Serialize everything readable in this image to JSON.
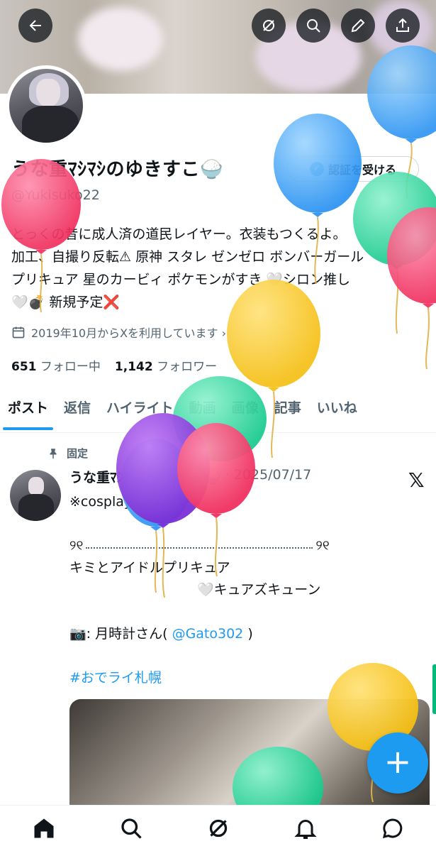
{
  "profile": {
    "display_name": "うな重ﾏｼﾏｼのゆきすこ🍚",
    "handle": "@Yukisuko22",
    "verify_label": "認証を受ける",
    "bio_lines": [
      "とっくの昔に成人済の道民レイヤー。衣装もつくるよ。",
      "加工、自撮り反転⚠ 原神 スタレ ゼンゼロ ボンバーガール",
      "プリキュア 星のカービィ ポケモンがすき 🤍シロン推し",
      "🤍💣 新規予定❌"
    ],
    "joined": "2019年10月からXを利用しています ›",
    "following_count": "651",
    "following_label": "フォロー中",
    "followers_count": "1,142",
    "followers_label": "フォロワー"
  },
  "tabs": [
    "ポスト",
    "返信",
    "ハイライト",
    "動画",
    "画像",
    "記事",
    "いいね"
  ],
  "post": {
    "pinned_label": "固定",
    "author": "うな重ﾏｼﾏｼのゆきすこ🍚",
    "date": "· 2025/07/17",
    "lines": {
      "l1": "※cosplay/コスプレ※",
      "l2": "",
      "l3_left": "୨୧",
      "l3_right": "୨୧",
      "l4": "キミとアイドルプリキュア",
      "l5": "🤍キュアズキューン",
      "l6": "",
      "l7_prefix": "📷: 月時計さん(",
      "l7_link": "@Gato302",
      "l7_suffix": ")",
      "l8": "",
      "l9_hashtag": "#おでライ札幌"
    }
  },
  "icons": {
    "header": [
      "back-arrow-icon",
      "grok-icon",
      "search-icon",
      "edit-icon",
      "share-icon"
    ],
    "nav": [
      "home-icon",
      "search-icon",
      "grok-icon",
      "notifications-icon",
      "messages-icon"
    ]
  },
  "colors": {
    "accent": "#1d9bf0",
    "text": "#0f1419",
    "muted": "#536471"
  }
}
